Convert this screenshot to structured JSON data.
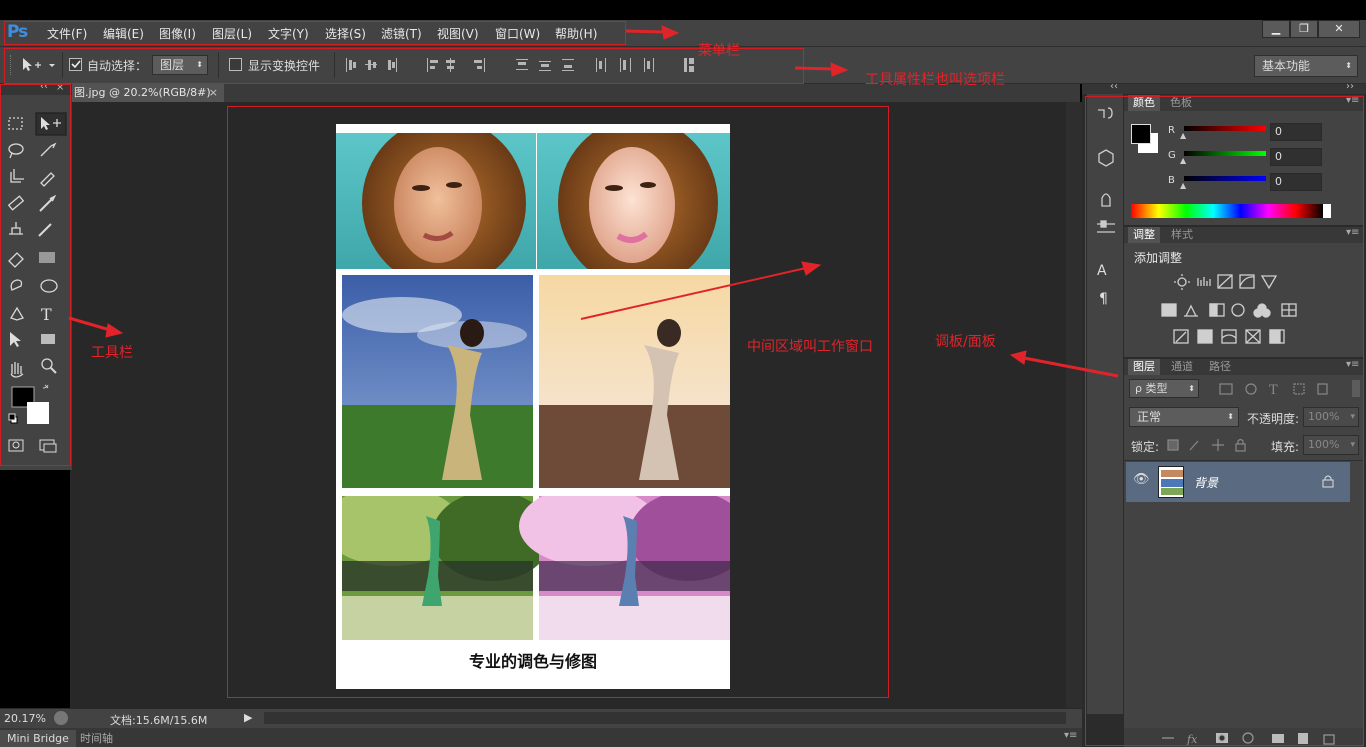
{
  "app": {
    "logo": "Ps"
  },
  "menu": [
    "文件(F)",
    "编辑(E)",
    "图像(I)",
    "图层(L)",
    "文字(Y)",
    "选择(S)",
    "滤镜(T)",
    "视图(V)",
    "窗口(W)",
    "帮助(H)"
  ],
  "window_controls": {
    "minimize": "▁",
    "restore": "❐",
    "close": "✕"
  },
  "options": {
    "auto_select_label": "自动选择：",
    "auto_select_checked": true,
    "auto_select_value": "图层",
    "show_transform_label": "显示变换控件",
    "show_transform_checked": false,
    "workspace": "基本功能"
  },
  "document": {
    "tab_title": "图.jpg @ 20.2%(RGB/8#)",
    "close": "×",
    "caption": "专业的调色与修图"
  },
  "status": {
    "zoom": "20.17%",
    "doc_info": "文档:15.6M/15.6M"
  },
  "bottom_tabs": [
    "Mini Bridge",
    "时间轴"
  ],
  "color_panel": {
    "tabs": [
      "颜色",
      "色板"
    ],
    "r_label": "R",
    "g_label": "G",
    "b_label": "B",
    "r": "0",
    "g": "0",
    "b": "0"
  },
  "adjust_panel": {
    "tabs": [
      "调整",
      "样式"
    ],
    "title": "添加调整"
  },
  "layers_panel": {
    "tabs": [
      "图层",
      "通道",
      "路径"
    ],
    "filter": "ρ 类型",
    "blend_mode": "正常",
    "opacity_label": "不透明度:",
    "opacity": "100%",
    "lock_label": "锁定:",
    "fill_label": "填充:",
    "fill": "100%",
    "layer_name": "背景"
  },
  "annotations": {
    "menubar": "菜单栏",
    "optionsbar": "工具属性栏也叫选项栏",
    "toolbar": "工具栏",
    "workarea": "中间区域叫工作窗口",
    "panels": "调板/面板"
  },
  "colors": {
    "annotation": "#e0242a",
    "chrome": "#434343",
    "canvas": "#282828"
  }
}
